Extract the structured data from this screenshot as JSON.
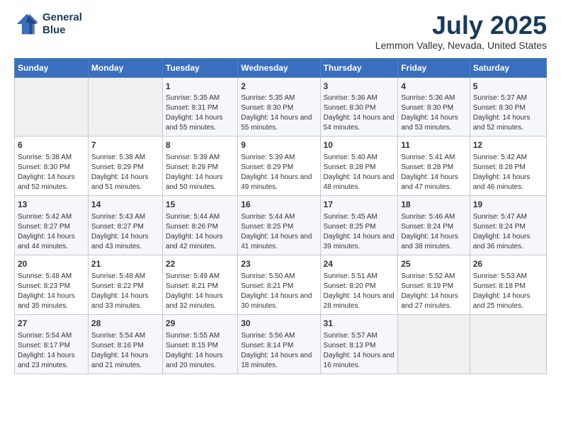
{
  "logo": {
    "line1": "General",
    "line2": "Blue"
  },
  "title": "July 2025",
  "location": "Lemmon Valley, Nevada, United States",
  "days_of_week": [
    "Sunday",
    "Monday",
    "Tuesday",
    "Wednesday",
    "Thursday",
    "Friday",
    "Saturday"
  ],
  "weeks": [
    [
      {
        "day": "",
        "sunrise": "",
        "sunset": "",
        "daylight": ""
      },
      {
        "day": "",
        "sunrise": "",
        "sunset": "",
        "daylight": ""
      },
      {
        "day": "1",
        "sunrise": "Sunrise: 5:35 AM",
        "sunset": "Sunset: 8:31 PM",
        "daylight": "Daylight: 14 hours and 55 minutes."
      },
      {
        "day": "2",
        "sunrise": "Sunrise: 5:35 AM",
        "sunset": "Sunset: 8:30 PM",
        "daylight": "Daylight: 14 hours and 55 minutes."
      },
      {
        "day": "3",
        "sunrise": "Sunrise: 5:36 AM",
        "sunset": "Sunset: 8:30 PM",
        "daylight": "Daylight: 14 hours and 54 minutes."
      },
      {
        "day": "4",
        "sunrise": "Sunrise: 5:36 AM",
        "sunset": "Sunset: 8:30 PM",
        "daylight": "Daylight: 14 hours and 53 minutes."
      },
      {
        "day": "5",
        "sunrise": "Sunrise: 5:37 AM",
        "sunset": "Sunset: 8:30 PM",
        "daylight": "Daylight: 14 hours and 52 minutes."
      }
    ],
    [
      {
        "day": "6",
        "sunrise": "Sunrise: 5:38 AM",
        "sunset": "Sunset: 8:30 PM",
        "daylight": "Daylight: 14 hours and 52 minutes."
      },
      {
        "day": "7",
        "sunrise": "Sunrise: 5:38 AM",
        "sunset": "Sunset: 8:29 PM",
        "daylight": "Daylight: 14 hours and 51 minutes."
      },
      {
        "day": "8",
        "sunrise": "Sunrise: 5:39 AM",
        "sunset": "Sunset: 8:29 PM",
        "daylight": "Daylight: 14 hours and 50 minutes."
      },
      {
        "day": "9",
        "sunrise": "Sunrise: 5:39 AM",
        "sunset": "Sunset: 8:29 PM",
        "daylight": "Daylight: 14 hours and 49 minutes."
      },
      {
        "day": "10",
        "sunrise": "Sunrise: 5:40 AM",
        "sunset": "Sunset: 8:28 PM",
        "daylight": "Daylight: 14 hours and 48 minutes."
      },
      {
        "day": "11",
        "sunrise": "Sunrise: 5:41 AM",
        "sunset": "Sunset: 8:28 PM",
        "daylight": "Daylight: 14 hours and 47 minutes."
      },
      {
        "day": "12",
        "sunrise": "Sunrise: 5:42 AM",
        "sunset": "Sunset: 8:28 PM",
        "daylight": "Daylight: 14 hours and 46 minutes."
      }
    ],
    [
      {
        "day": "13",
        "sunrise": "Sunrise: 5:42 AM",
        "sunset": "Sunset: 8:27 PM",
        "daylight": "Daylight: 14 hours and 44 minutes."
      },
      {
        "day": "14",
        "sunrise": "Sunrise: 5:43 AM",
        "sunset": "Sunset: 8:27 PM",
        "daylight": "Daylight: 14 hours and 43 minutes."
      },
      {
        "day": "15",
        "sunrise": "Sunrise: 5:44 AM",
        "sunset": "Sunset: 8:26 PM",
        "daylight": "Daylight: 14 hours and 42 minutes."
      },
      {
        "day": "16",
        "sunrise": "Sunrise: 5:44 AM",
        "sunset": "Sunset: 8:25 PM",
        "daylight": "Daylight: 14 hours and 41 minutes."
      },
      {
        "day": "17",
        "sunrise": "Sunrise: 5:45 AM",
        "sunset": "Sunset: 8:25 PM",
        "daylight": "Daylight: 14 hours and 39 minutes."
      },
      {
        "day": "18",
        "sunrise": "Sunrise: 5:46 AM",
        "sunset": "Sunset: 8:24 PM",
        "daylight": "Daylight: 14 hours and 38 minutes."
      },
      {
        "day": "19",
        "sunrise": "Sunrise: 5:47 AM",
        "sunset": "Sunset: 8:24 PM",
        "daylight": "Daylight: 14 hours and 36 minutes."
      }
    ],
    [
      {
        "day": "20",
        "sunrise": "Sunrise: 5:48 AM",
        "sunset": "Sunset: 8:23 PM",
        "daylight": "Daylight: 14 hours and 35 minutes."
      },
      {
        "day": "21",
        "sunrise": "Sunrise: 5:48 AM",
        "sunset": "Sunset: 8:22 PM",
        "daylight": "Daylight: 14 hours and 33 minutes."
      },
      {
        "day": "22",
        "sunrise": "Sunrise: 5:49 AM",
        "sunset": "Sunset: 8:21 PM",
        "daylight": "Daylight: 14 hours and 32 minutes."
      },
      {
        "day": "23",
        "sunrise": "Sunrise: 5:50 AM",
        "sunset": "Sunset: 8:21 PM",
        "daylight": "Daylight: 14 hours and 30 minutes."
      },
      {
        "day": "24",
        "sunrise": "Sunrise: 5:51 AM",
        "sunset": "Sunset: 8:20 PM",
        "daylight": "Daylight: 14 hours and 28 minutes."
      },
      {
        "day": "25",
        "sunrise": "Sunrise: 5:52 AM",
        "sunset": "Sunset: 8:19 PM",
        "daylight": "Daylight: 14 hours and 27 minutes."
      },
      {
        "day": "26",
        "sunrise": "Sunrise: 5:53 AM",
        "sunset": "Sunset: 8:18 PM",
        "daylight": "Daylight: 14 hours and 25 minutes."
      }
    ],
    [
      {
        "day": "27",
        "sunrise": "Sunrise: 5:54 AM",
        "sunset": "Sunset: 8:17 PM",
        "daylight": "Daylight: 14 hours and 23 minutes."
      },
      {
        "day": "28",
        "sunrise": "Sunrise: 5:54 AM",
        "sunset": "Sunset: 8:16 PM",
        "daylight": "Daylight: 14 hours and 21 minutes."
      },
      {
        "day": "29",
        "sunrise": "Sunrise: 5:55 AM",
        "sunset": "Sunset: 8:15 PM",
        "daylight": "Daylight: 14 hours and 20 minutes."
      },
      {
        "day": "30",
        "sunrise": "Sunrise: 5:56 AM",
        "sunset": "Sunset: 8:14 PM",
        "daylight": "Daylight: 14 hours and 18 minutes."
      },
      {
        "day": "31",
        "sunrise": "Sunrise: 5:57 AM",
        "sunset": "Sunset: 8:13 PM",
        "daylight": "Daylight: 14 hours and 16 minutes."
      },
      {
        "day": "",
        "sunrise": "",
        "sunset": "",
        "daylight": ""
      },
      {
        "day": "",
        "sunrise": "",
        "sunset": "",
        "daylight": ""
      }
    ]
  ]
}
